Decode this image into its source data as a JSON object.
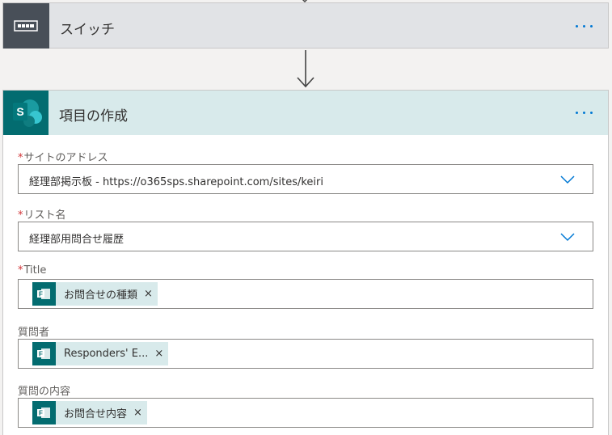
{
  "switch_step": {
    "title": "スイッチ",
    "more_label": "..."
  },
  "create_step": {
    "title": "項目の作成",
    "more_label": "...",
    "fields": {
      "site_address": {
        "required": "*",
        "label": "サイトのアドレス",
        "value": "経理部掲示板 - https://o365sps.sharepoint.com/sites/keiri"
      },
      "list_name": {
        "required": "*",
        "label": "リスト名",
        "value": "経理部用問合せ履歴"
      },
      "title": {
        "required": "*",
        "label": "Title",
        "token": "お問合せの種類",
        "remove": "×"
      },
      "questioner": {
        "label": "質問者",
        "token": "Responders' E...",
        "remove": "×"
      },
      "question_content": {
        "label": "質問の内容",
        "token": "お問合せ内容",
        "remove": "×"
      }
    }
  },
  "colors": {
    "accent": "#0078d4",
    "sharepoint_teal": "#036c70",
    "header_teal": "#d8eaeb",
    "switch_header": "#e1e3e6",
    "required": "#d13438"
  },
  "icons": [
    "switch-icon",
    "sharepoint-icon",
    "chevron-down-icon",
    "forms-icon",
    "arrow-down-icon",
    "more-icon",
    "close-icon"
  ]
}
